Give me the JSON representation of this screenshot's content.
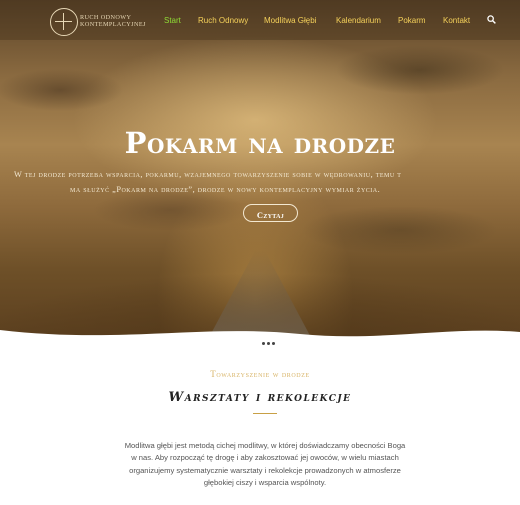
{
  "brand": {
    "line1": "RUCH ODNOWY",
    "line2": "KONTEMPLACYJNEJ"
  },
  "nav": {
    "items": [
      {
        "label": "Start",
        "active": true
      },
      {
        "label": "Ruch Odnowy",
        "active": false
      },
      {
        "label": "Modlitwa Głębi",
        "active": false
      },
      {
        "label": "Kalendarium",
        "active": false
      },
      {
        "label": "Pokarm",
        "active": false
      },
      {
        "label": "Kontakt",
        "active": false
      }
    ],
    "search_icon": "search-icon"
  },
  "hero": {
    "title": "Pokarm na drodze",
    "subtitle_line1": "W tej drodze potrzeba wsparcia, pokarmu, wzajemnego towarzyszenie sobie w wędrowaniu, temu t",
    "subtitle_line2": "ma służyć „Pokarm na drodze”, drodze w nowy kontemplacyjny wymiar życia.",
    "button_label": "Czytaj"
  },
  "slider": {
    "dot_count": 3
  },
  "section": {
    "eyebrow": "Towarzyszenie w drodze",
    "title": "Warsztaty i rekolekcje",
    "body_line1": "Modlitwa głębi jest metodą cichej modlitwy, w której doświadczamy obecności Boga",
    "body_line2": "w nas. Aby rozpocząć tę drogę i aby zakosztować jej owoców, w wielu miastach",
    "body_line3": "organizujemy systematycznie warsztaty i rekolekcje prowadzonych w atmosferze",
    "body_line4": "głębokiej ciszy i wsparcia wspólnoty."
  },
  "colors": {
    "nav_text": "#f5d15a",
    "nav_active": "#8fdc35",
    "gold": "#d8b467"
  }
}
